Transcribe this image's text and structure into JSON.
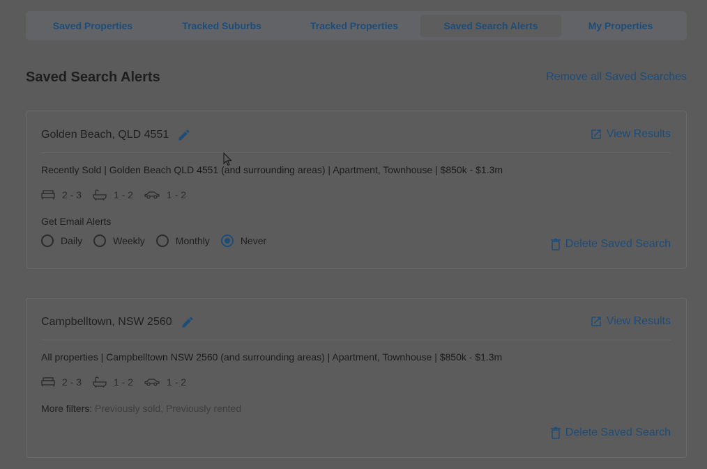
{
  "tabs": [
    {
      "label": "Saved Properties"
    },
    {
      "label": "Tracked Suburbs"
    },
    {
      "label": "Tracked Properties"
    },
    {
      "label": "Saved Search Alerts"
    },
    {
      "label": "My Properties"
    }
  ],
  "active_tab": "Saved Search Alerts",
  "section": {
    "title": "Saved Search Alerts",
    "remove_all_label": "Remove all Saved Searches"
  },
  "searches": [
    {
      "title": "Golden Beach, QLD 4551",
      "view_results_label": "View Results",
      "summary": "Recently Sold | Golden Beach QLD 4551 (and surrounding areas) | Apartment, Townhouse | $850k - $1.3m",
      "beds": "2 - 3",
      "baths": "1 - 2",
      "cars": "1 - 2",
      "alerts_label": "Get Email Alerts",
      "alert_options": [
        "Daily",
        "Weekly",
        "Monthly",
        "Never"
      ],
      "alert_selected": "Never",
      "delete_label": "Delete Saved Search"
    },
    {
      "title": "Campbelltown, NSW 2560",
      "view_results_label": "View Results",
      "summary": "All properties | Campbelltown NSW 2560 (and surrounding areas) | Apartment, Townhouse | $850k - $1.3m",
      "beds": "2 - 3",
      "baths": "1 - 2",
      "cars": "1 - 2",
      "more_filters_label": "More filters:",
      "more_filters_value": "Previously sold, Previously rented",
      "delete_label": "Delete Saved Search"
    }
  ],
  "colors": {
    "accent": "#1d4c78",
    "overlay_bg": "#5b5b5b"
  }
}
